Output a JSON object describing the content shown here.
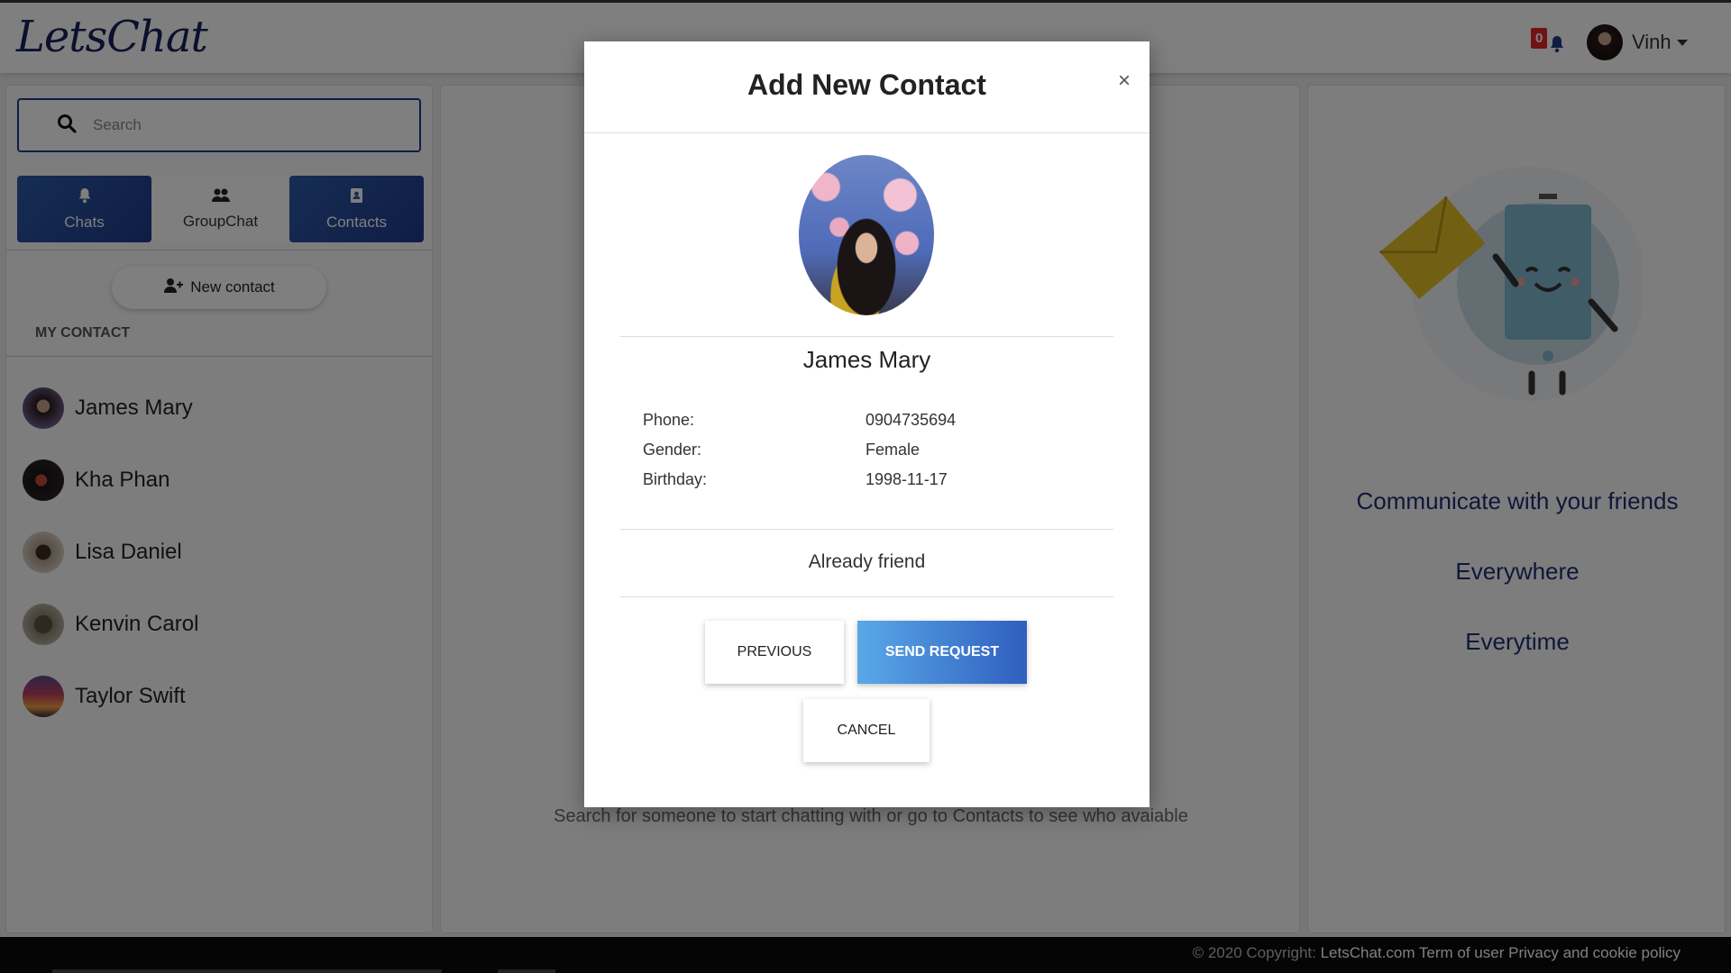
{
  "app": {
    "logo": "LetsChat",
    "notification_count": "0",
    "user_name": "Vinh"
  },
  "sidebar": {
    "search_placeholder": "Search",
    "tabs": [
      {
        "label": "Chats",
        "icon": "bell-icon",
        "active": true
      },
      {
        "label": "GroupChat",
        "icon": "users-icon",
        "active": false
      },
      {
        "label": "Contacts",
        "icon": "address-book-icon",
        "active": true
      }
    ],
    "new_contact_label": "New contact",
    "section_title": "MY CONTACT",
    "contacts": [
      {
        "name": "James Mary"
      },
      {
        "name": "Kha Phan"
      },
      {
        "name": "Lisa Daniel"
      },
      {
        "name": "Kenvin Carol"
      },
      {
        "name": "Taylor Swift"
      }
    ]
  },
  "main": {
    "empty_text": "Search for someone to start chatting with or go to Contacts to see who avaiable"
  },
  "right_panel": {
    "line1": "Communicate with your friends",
    "line2": "Everywhere",
    "line3": "Everytime"
  },
  "modal": {
    "title": "Add New Contact",
    "close": "×",
    "name": "James Mary",
    "fields": [
      {
        "label": "Phone:",
        "value": "0904735694"
      },
      {
        "label": "Gender:",
        "value": "Female"
      },
      {
        "label": "Birthday:",
        "value": "1998-11-17"
      }
    ],
    "status": "Already friend",
    "previous_label": "PREVIOUS",
    "send_label": "SEND REQUEST",
    "cancel_label": "CANCEL"
  },
  "footer": {
    "copyright": "© 2020 Copyright:",
    "site": "LetsChat.com",
    "terms": "Term of user",
    "privacy": "Privacy and cookie policy"
  },
  "colors": {
    "brand": "#1e3a8a",
    "accent_gradient_start": "#5aa8e8",
    "accent_gradient_end": "#2f5fbf",
    "badge": "#e3262a"
  }
}
